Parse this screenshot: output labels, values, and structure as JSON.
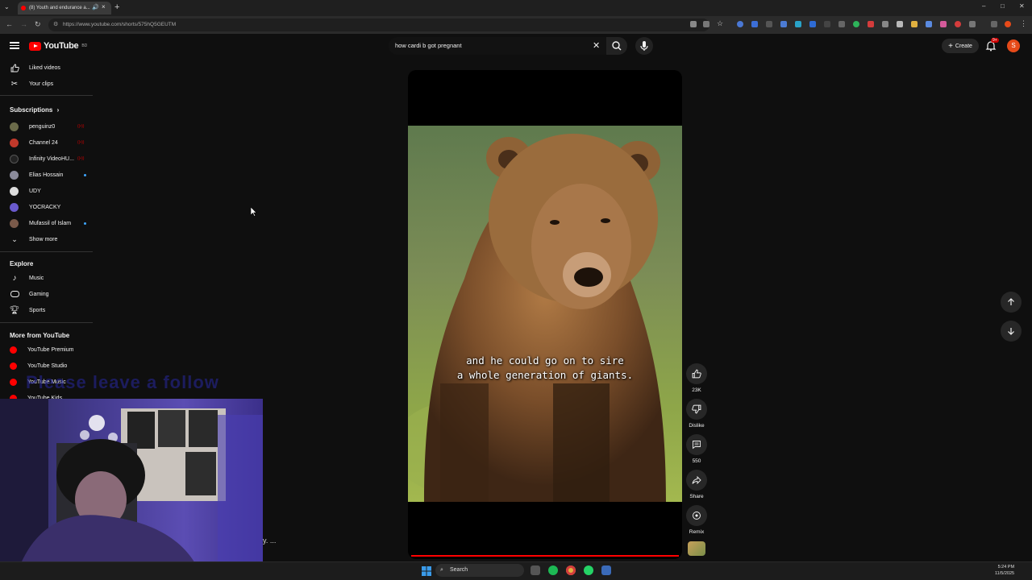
{
  "browser": {
    "tab_title": "(8) Youth and endurance a...",
    "url": "https://www.youtube.com/shorts/575hQ5GEUTM",
    "new_tab_glyph": "+",
    "window_controls": [
      "–",
      "□",
      "✕"
    ]
  },
  "masthead": {
    "logo_text": "YouTube",
    "logo_region": "BD",
    "search_value": "how cardi b got pregnant",
    "create_label": "Create",
    "notification_count": "9+",
    "avatar_letter": "S"
  },
  "sidebar": {
    "top_items": [
      {
        "label": "Liked videos",
        "icon": "thumbs-up-icon"
      },
      {
        "label": "Your clips",
        "icon": "scissors-icon"
      }
    ],
    "subscriptions_title": "Subscriptions",
    "subscriptions": [
      {
        "label": "penguinz0",
        "status": "live",
        "avatar_color": "#6b6b4a"
      },
      {
        "label": "Channel 24",
        "status": "live",
        "avatar_color": "#c0392b"
      },
      {
        "label": "Infinity VideoHU...",
        "status": "live",
        "avatar_color": "#222222"
      },
      {
        "label": "Elias Hossain",
        "status": "new",
        "avatar_color": "#8a8a9a"
      },
      {
        "label": "UDY",
        "status": "",
        "avatar_color": "#dddddd"
      },
      {
        "label": "YOCRACKY",
        "status": "",
        "avatar_color": "#6a5acd"
      },
      {
        "label": "Mufassil of Islam",
        "status": "new",
        "avatar_color": "#7a5a4a"
      }
    ],
    "show_more_label": "Show more",
    "explore_title": "Explore",
    "explore": [
      {
        "label": "Music",
        "icon": "music-note-icon"
      },
      {
        "label": "Gaming",
        "icon": "gamepad-icon"
      },
      {
        "label": "Sports",
        "icon": "trophy-icon"
      }
    ],
    "more_title": "More from YouTube",
    "more": [
      {
        "label": "YouTube Premium"
      },
      {
        "label": "YouTube Studio"
      },
      {
        "label": "YouTube Music"
      },
      {
        "label": "YouTube Kids"
      }
    ]
  },
  "short": {
    "caption_line1": "and he could go on to sire",
    "caption_line2": "a whole generation of giants.",
    "progress": 1.0
  },
  "actions": {
    "likes": "23K",
    "dislike_label": "Dislike",
    "comments": "550",
    "share_label": "Share",
    "remix_label": "Remix"
  },
  "overlay": {
    "watermark_text": "Please leave a follow",
    "ellipsis": "y. ..."
  },
  "taskbar": {
    "search_label": "Search",
    "time": "5:24 PM",
    "date": "11/5/2025"
  }
}
